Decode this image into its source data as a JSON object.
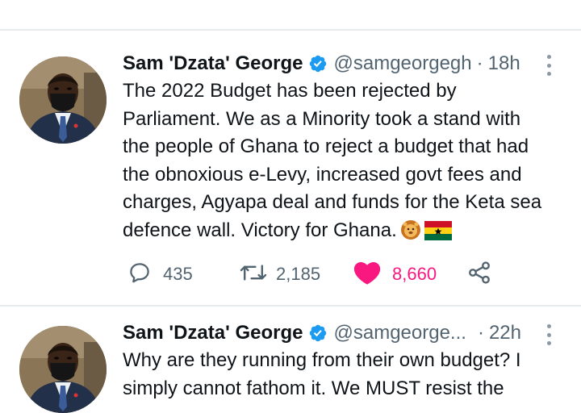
{
  "tweets": [
    {
      "author_name": "Sam 'Dzata' George",
      "handle": "@samgeorgegh",
      "separator": "·",
      "time": "18h",
      "text": "The 2022 Budget has been rejected by\nParliament. We as a Minority took a stand with\nthe people of Ghana to reject a budget that had\nthe obnoxious e-Levy, increased govt fees and\ncharges, Agyapa deal and funds for the Keta sea\ndefence wall. Victory for Ghana.",
      "emojis": [
        "lion-face",
        "flag-ghana"
      ],
      "replies": "435",
      "retweets": "2,185",
      "likes": "8,660",
      "liked": true
    },
    {
      "author_name": "Sam 'Dzata' George",
      "handle": "@samgeorge...",
      "separator": "·",
      "time": "22h",
      "text": "Why are they running from their own budget? I\nsimply cannot fathom it. We MUST resist the"
    }
  ],
  "colors": {
    "verified": "#1d9bf0",
    "like": "#f91880",
    "muted": "#536471",
    "text": "#0f1419"
  },
  "icons": [
    "verified-badge-icon",
    "more-options-icon",
    "reply-icon",
    "retweet-icon",
    "heart-icon",
    "share-icon"
  ]
}
